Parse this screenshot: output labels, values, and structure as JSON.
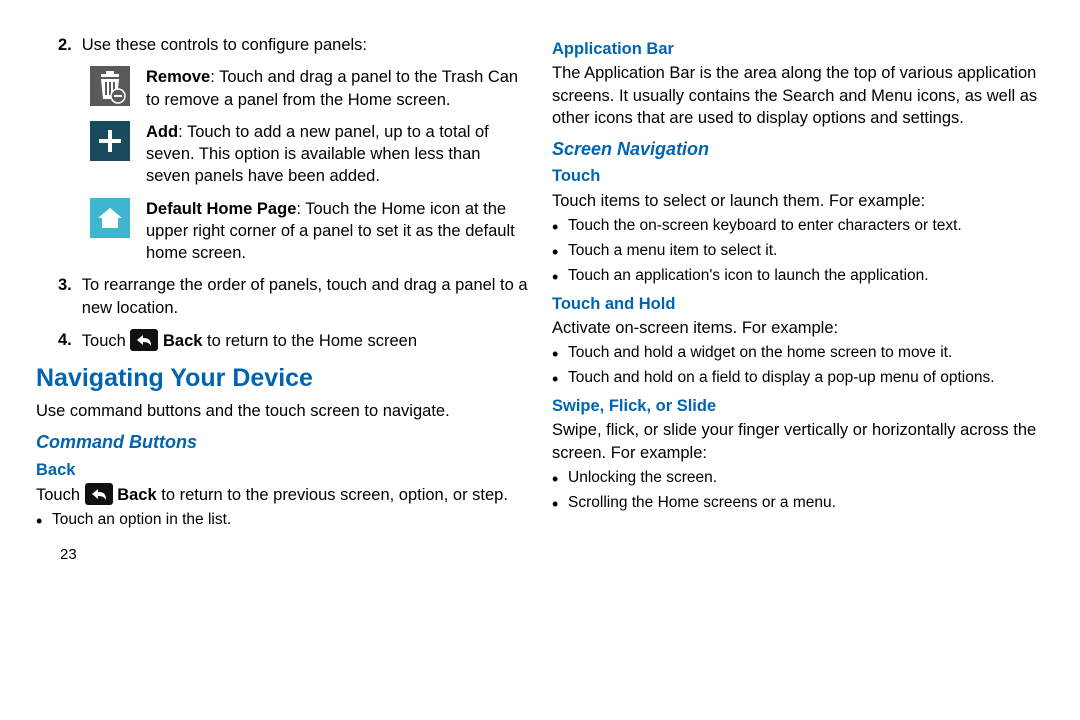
{
  "left": {
    "item2_num": "2.",
    "item2_text": "Use these controls to configure panels:",
    "remove_label": "Remove",
    "remove_text": ": Touch and drag a panel to the Trash Can to remove a panel from the Home screen.",
    "add_label": "Add",
    "add_text": ": Touch to add a new panel, up to a total of seven. This option is available when less than seven panels have been added.",
    "default_label": "Default Home Page",
    "default_text": ": Touch the Home icon at the upper right corner of a panel to set it as the default home screen.",
    "item3_num": "3.",
    "item3_text": "To rearrange the order of panels, touch and drag a panel to a new location.",
    "item4_num": "4.",
    "item4_touch": "Touch ",
    "item4_back": " Back",
    "item4_rest": " to return to the Home screen",
    "nav_heading": "Navigating Your Device",
    "nav_intro": "Use command buttons and the touch screen to navigate.",
    "cmd_heading": "Command Buttons",
    "back_heading": "Back",
    "back_touch": "Touch ",
    "back_label": " Back",
    "back_rest": " to return to the previous screen, option, or step.",
    "back_bullet": "Touch an option in the list.",
    "page_num": "23"
  },
  "right": {
    "appbar_heading": "Application Bar",
    "appbar_text": "The Application Bar is the area along the top of various application screens. It usually contains the Search and Menu icons, as well as other icons that are used to display options and settings.",
    "screen_nav_heading": "Screen Navigation",
    "touch_heading": "Touch",
    "touch_intro": "Touch items to select or launch them. For example:",
    "touch_b1": "Touch the on-screen keyboard to enter characters or text.",
    "touch_b2": "Touch a menu item to select it.",
    "touch_b3": "Touch an application's icon to launch the application.",
    "hold_heading": "Touch and Hold",
    "hold_intro": "Activate on-screen items. For example:",
    "hold_b1": "Touch and hold a widget on the home screen to move it.",
    "hold_b2": "Touch and hold on a field to display a pop-up menu of options.",
    "swipe_heading": "Swipe, Flick, or Slide",
    "swipe_intro": "Swipe, flick, or slide your finger vertically or horizontally across the screen. For example:",
    "swipe_b1": "Unlocking the screen.",
    "swipe_b2": "Scrolling the Home screens or a menu."
  }
}
